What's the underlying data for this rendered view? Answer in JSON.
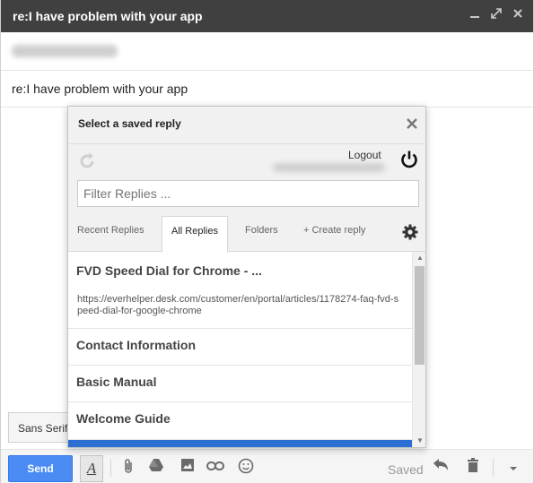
{
  "compose": {
    "title": "re:I have problem with your app",
    "subject": "re:I have problem with your app",
    "font_select": "Sans Serif",
    "window_controls": [
      "minimize-icon",
      "popout-icon",
      "close-icon"
    ]
  },
  "toolbar": {
    "send_label": "Send",
    "format_label": "A",
    "saved_label": "Saved",
    "icons": [
      "paperclip-icon",
      "drive-icon",
      "photo-icon",
      "link-icon",
      "emoji-icon",
      "undo-icon",
      "trash-icon",
      "more-options-icon"
    ]
  },
  "popup": {
    "title": "Select a saved reply",
    "logout_label": "Logout",
    "filter_placeholder": "Filter Replies ...",
    "tabs": [
      {
        "label": "Recent Replies",
        "active": false
      },
      {
        "label": "All Replies",
        "active": true
      },
      {
        "label": "Folders",
        "active": false
      },
      {
        "label": "+ Create reply",
        "active": false
      }
    ],
    "replies": [
      {
        "title": "FVD Speed Dial for Chrome - ...",
        "url": "https://everhelper.desk.com/customer/en/portal/articles/1178274-faq-fvd-speed-dial-for-google-chrome"
      },
      {
        "title": "Contact Information"
      },
      {
        "title": "Basic Manual"
      },
      {
        "title": "Welcome Guide"
      }
    ]
  },
  "colors": {
    "titlebar": "#404040",
    "send_button": "#4b8cf4",
    "selected_row": "#2c6fd3"
  }
}
